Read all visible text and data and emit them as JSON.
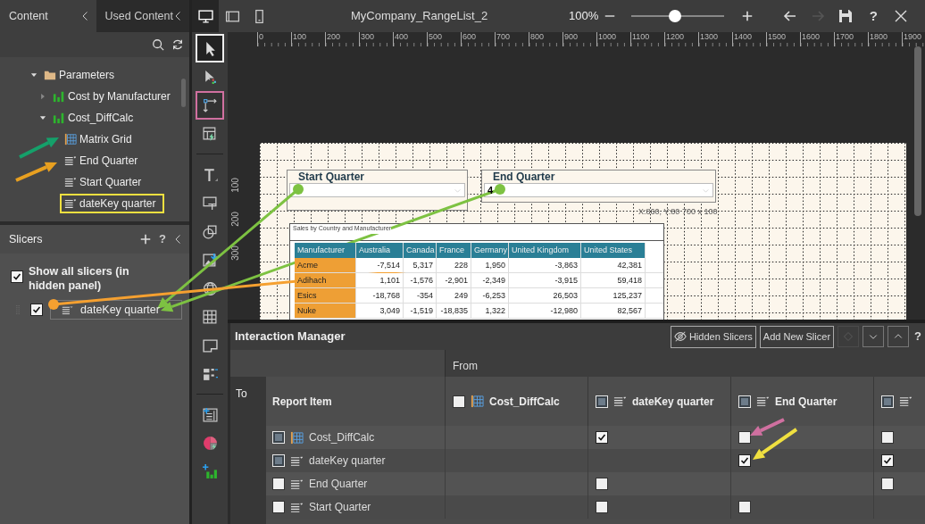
{
  "header": {
    "devices": [
      {
        "kind": "monitor",
        "selected": true
      },
      {
        "kind": "tablet",
        "selected": false
      },
      {
        "kind": "phone",
        "selected": false
      }
    ],
    "title": "MyCompany_RangeList_2",
    "zoom": {
      "reading": "100%",
      "level": 0.47
    },
    "actions": [
      {
        "kind": "back",
        "disabled": false
      },
      {
        "kind": "forward",
        "disabled": true
      },
      {
        "kind": "save",
        "disabled": false
      },
      {
        "kind": "help",
        "label": "?",
        "disabled": false
      },
      {
        "kind": "close",
        "disabled": false
      }
    ]
  },
  "panel_tabs": [
    {
      "label": "Content",
      "selected": true
    },
    {
      "label": "Used Content",
      "selected": false
    }
  ],
  "tree": [
    {
      "label": "Parameters",
      "kind": "folder",
      "expanded": true,
      "highlighted": false,
      "children": [
        {
          "label": "Cost by Manufacturer",
          "kind": "chart",
          "expanded": false,
          "highlighted": false
        },
        {
          "label": "Cost_DiffCalc",
          "kind": "chart",
          "expanded": true,
          "highlighted": false,
          "children": [
            {
              "label": "Matrix Grid",
              "kind": "grid",
              "highlighted": false
            },
            {
              "label": "End Quarter",
              "kind": "slicer",
              "highlighted": false
            },
            {
              "label": "Start Quarter",
              "kind": "slicer",
              "highlighted": false
            },
            {
              "label": "dateKey quarter",
              "kind": "slicer",
              "highlighted": true
            }
          ]
        }
      ]
    }
  ],
  "slicers": {
    "title": "Slicers",
    "help": "?",
    "show_all": {
      "label": "Show all slicers (in hidden panel)",
      "checked": true
    },
    "items": [
      {
        "label": "dateKey quarter",
        "checked": true
      }
    ]
  },
  "toolbar": [
    {
      "kind": "select",
      "selected": true,
      "highlighted": false
    },
    {
      "kind": "pointer",
      "selected": false,
      "highlighted": false
    },
    {
      "kind": "interaction",
      "selected": false,
      "highlighted": true
    },
    {
      "kind": "widget",
      "selected": false,
      "highlighted": false
    },
    {
      "kind": "separator"
    },
    {
      "kind": "text",
      "selected": false,
      "highlighted": false
    },
    {
      "kind": "label",
      "selected": false,
      "highlighted": false
    },
    {
      "kind": "shapes",
      "selected": false,
      "highlighted": false
    },
    {
      "kind": "image",
      "selected": false,
      "highlighted": false
    },
    {
      "kind": "globe",
      "selected": false,
      "highlighted": false
    },
    {
      "kind": "table",
      "selected": false,
      "highlighted": false
    },
    {
      "kind": "note",
      "selected": false,
      "highlighted": false
    },
    {
      "kind": "pivot",
      "selected": false,
      "highlighted": false
    },
    {
      "kind": "separator"
    },
    {
      "kind": "report",
      "selected": false,
      "highlighted": false
    },
    {
      "kind": "pie",
      "selected": false,
      "highlighted": false
    },
    {
      "kind": "addchart",
      "selected": false,
      "highlighted": false
    }
  ],
  "canvas": {
    "ruler": [
      "0",
      "100",
      "200",
      "300",
      "400",
      "500",
      "600",
      "700",
      "800",
      "900",
      "1000",
      "1100",
      "1200",
      "1300",
      "1400",
      "1500",
      "1600",
      "1700",
      "1800",
      "1900"
    ],
    "side_ruler": [
      "100",
      "200",
      "300"
    ],
    "slicers": [
      {
        "title": "Start Quarter"
      },
      {
        "title": "End Quarter",
        "value": "4"
      }
    ],
    "position": "X:860, Y:80 700 x 100",
    "table": {
      "title": "Sales by Country and Manufacturer",
      "columns": [
        "Manufacturer",
        "Australia",
        "Canada",
        "France",
        "Germany",
        "United Kingdom",
        "United States"
      ],
      "rows": [
        [
          "Acme",
          "-7,514",
          "5,317",
          "228",
          "1,950",
          "-3,863",
          "42,381"
        ],
        [
          "Adihach",
          "1,101",
          "-1,576",
          "-2,901",
          "-2,349",
          "-3,915",
          "59,418"
        ],
        [
          "Esics",
          "-18,768",
          "-354",
          "249",
          "-6,253",
          "26,503",
          "125,237"
        ],
        [
          "Nuke",
          "3,049",
          "-1,519",
          "-18,835",
          "1,322",
          "-12,980",
          "82,567"
        ]
      ]
    }
  },
  "interaction_manager": {
    "title": "Interaction Manager",
    "buttons": [
      {
        "kind": "hidden",
        "label": "Hidden Slicers"
      },
      {
        "kind": "plain",
        "label": "Add New Slicer"
      }
    ],
    "nav": [
      {
        "kind": "diamond",
        "disabled": true
      },
      {
        "kind": "down",
        "disabled": false
      },
      {
        "kind": "up",
        "disabled": false
      }
    ],
    "help": "?",
    "from_label": "From",
    "to_label": "To",
    "item_header": "Report Item",
    "columns": [
      {
        "label": "Cost_DiffCalc",
        "kind": "grid",
        "checked": false,
        "mixed": false
      },
      {
        "label": "dateKey quarter",
        "kind": "slicer",
        "checked": false,
        "mixed": true
      },
      {
        "label": "End Quarter",
        "kind": "slicer",
        "checked": false,
        "mixed": true
      },
      {
        "kind": "slicer",
        "checked": false,
        "mixed": true
      }
    ],
    "rows": [
      {
        "label": "Cost_DiffCalc",
        "kind": "grid",
        "checked": false,
        "mixed": true,
        "cells": [
          {
            "kind": "none"
          },
          {
            "kind": "checkbox",
            "checked": true
          },
          {
            "kind": "checkbox",
            "checked": false
          },
          {
            "kind": "checkbox",
            "checked": false
          }
        ]
      },
      {
        "label": "dateKey quarter",
        "kind": "slicer",
        "checked": false,
        "mixed": true,
        "cells": [
          {
            "kind": "none"
          },
          {
            "kind": "none"
          },
          {
            "kind": "checkbox",
            "checked": true
          },
          {
            "kind": "checkbox",
            "checked": true
          }
        ]
      },
      {
        "label": "End Quarter",
        "kind": "slicer",
        "checked": false,
        "mixed": false,
        "cells": [
          {
            "kind": "none"
          },
          {
            "kind": "checkbox",
            "checked": false
          },
          {
            "kind": "none"
          },
          {
            "kind": "checkbox",
            "checked": false
          }
        ]
      },
      {
        "label": "Start Quarter",
        "kind": "slicer",
        "checked": false,
        "mixed": false,
        "cells": [
          {
            "kind": "none"
          },
          {
            "kind": "checkbox",
            "checked": false
          },
          {
            "kind": "checkbox",
            "checked": false
          },
          {
            "kind": "none"
          }
        ]
      }
    ]
  }
}
